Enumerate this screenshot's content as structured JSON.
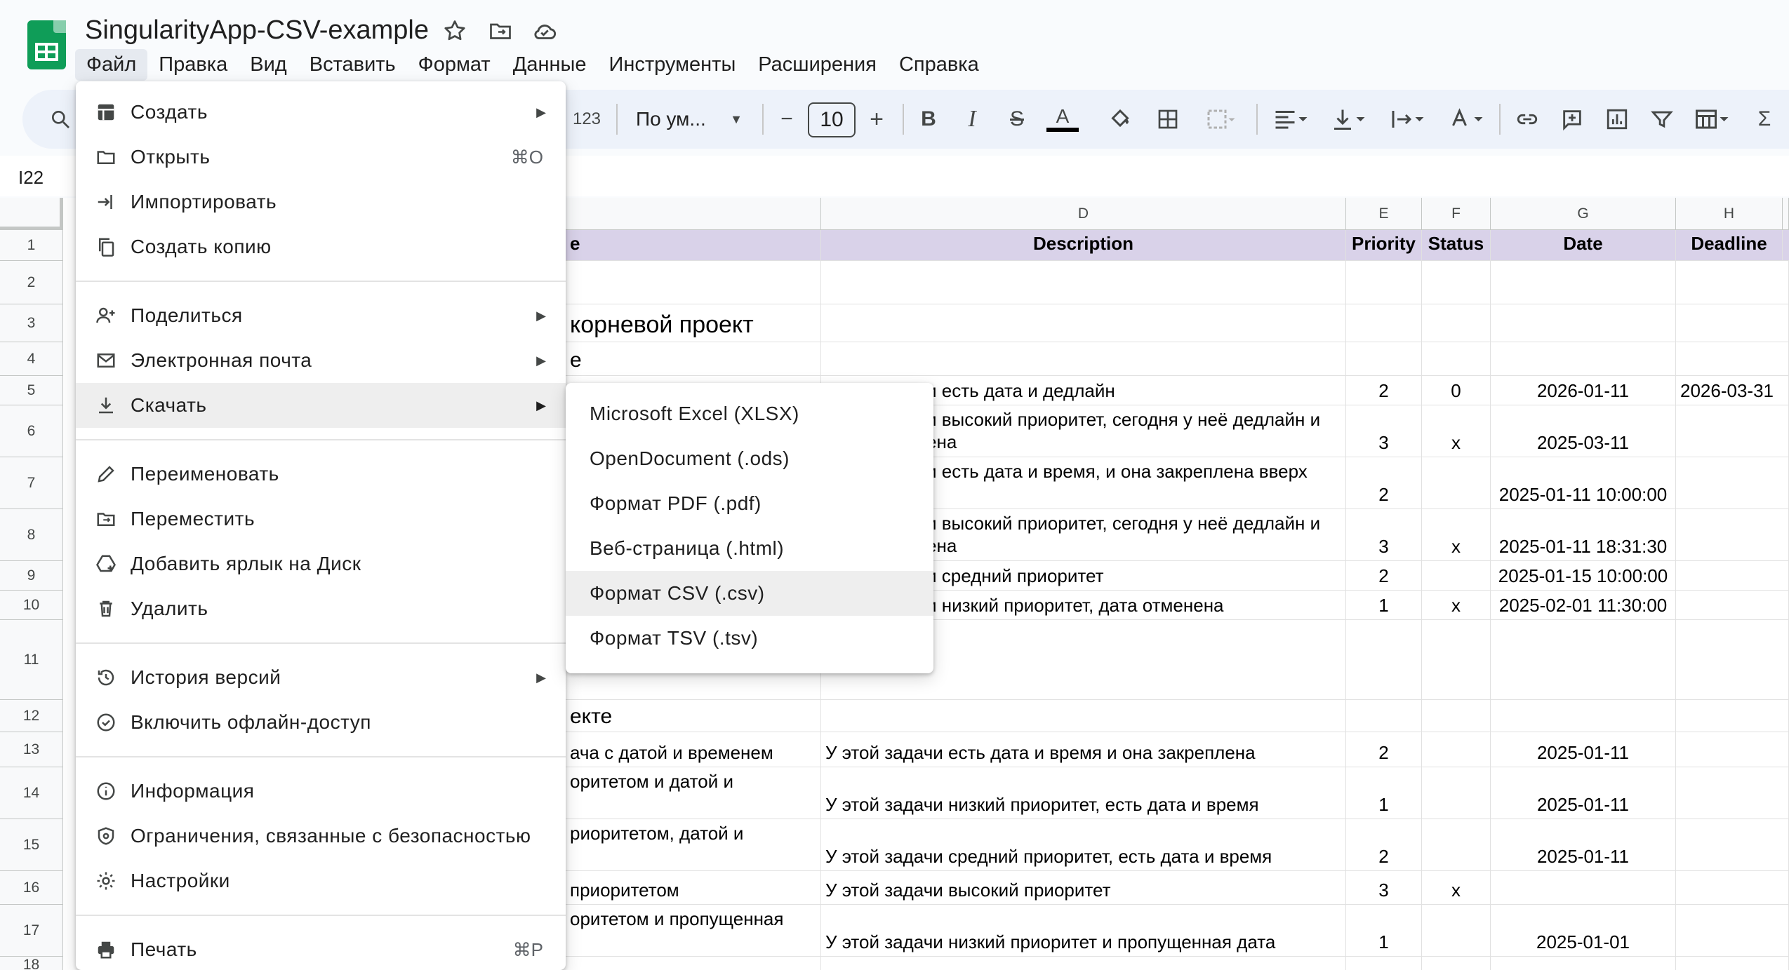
{
  "title_bar": {
    "doc_title": "SingularityApp-CSV-example"
  },
  "menubar": [
    "Файл",
    "Правка",
    "Вид",
    "Вставить",
    "Формат",
    "Данные",
    "Инструменты",
    "Расширения",
    "Справка"
  ],
  "toolbar": {
    "number_format_label": "123",
    "font_name": "По ум...",
    "font_size": "10",
    "text_color": "#000000"
  },
  "namebox": "I22",
  "columns": {
    "D": "D",
    "E": "E",
    "F": "F",
    "G": "G",
    "H": "H"
  },
  "rows": [
    "1",
    "2",
    "3",
    "4",
    "5",
    "6",
    "7",
    "8",
    "9",
    "10",
    "11",
    "12",
    "13",
    "14",
    "15",
    "16",
    "17",
    "18"
  ],
  "header_row": {
    "C_fragment": "e",
    "D": "Description",
    "E": "Priority",
    "F": "Status",
    "G": "Date",
    "H": "Deadline"
  },
  "cells": {
    "r3_C": "корневой проект",
    "r4_C": "е",
    "r5_D": "и есть дата и дедлайн",
    "r5_E": "2",
    "r5_F": "0",
    "r5_G": "2026-01-11",
    "r5_H": "2026-03-31",
    "r6_D": "и высокий приоритет, сегодня у неё дедлайн и ена",
    "r6_E": "3",
    "r6_F": "x",
    "r6_G": "2025-03-11",
    "r7_D": "и есть дата и время, и она закреплена вверх",
    "r7_E": "2",
    "r7_G": "2025-01-11 10:00:00",
    "r8_D": "и высокий приоритет, сегодня у неё дедлайн и ена",
    "r8_E": "3",
    "r8_F": "x",
    "r8_G": "2025-01-11 18:31:30",
    "r9_D": "и средний приоритет",
    "r9_E": "2",
    "r9_G": "2025-01-15 10:00:00",
    "r10_D": "и низкий приоритет, дата отменена",
    "r10_E": "1",
    "r10_F": "x",
    "r10_G": "2025-02-01 11:30:00",
    "r12_C": "екте",
    "r13_C": "ача с датой и временем",
    "r13_D": "У этой задачи есть дата и время и она закреплена",
    "r13_E": "2",
    "r13_G": "2025-01-11",
    "r14_C": "оритетом и датой и",
    "r14_D": "У этой задачи низкий приоритет, есть дата и время",
    "r14_E": "1",
    "r14_G": "2025-01-11",
    "r15_C": "риоритетом, датой и",
    "r15_D": "У этой задачи средний приоритет, есть дата и время",
    "r15_E": "2",
    "r15_G": "2025-01-11",
    "r16_C": "приоритетом",
    "r16_D": "У этой задачи высокий приоритет",
    "r16_E": "3",
    "r16_F": "x",
    "r17_C": "оритетом и пропущенная",
    "r17_D": "У этой задачи низкий приоритет и пропущенная дата",
    "r17_E": "1",
    "r17_G": "2025-01-01"
  },
  "file_menu": {
    "items": [
      {
        "label": "Создать",
        "icon": "new-sheet-icon",
        "submenu": true
      },
      {
        "label": "Открыть",
        "icon": "folder-icon",
        "shortcut": "⌘O"
      },
      {
        "label": "Импортировать",
        "icon": "import-icon"
      },
      {
        "label": "Создать копию",
        "icon": "copy-icon"
      },
      {
        "label": "Поделиться",
        "icon": "share-person-icon",
        "submenu": true
      },
      {
        "label": "Электронная почта",
        "icon": "mail-icon",
        "submenu": true
      },
      {
        "label": "Скачать",
        "icon": "download-icon",
        "submenu": true
      },
      {
        "label": "Переименовать",
        "icon": "pencil-icon"
      },
      {
        "label": "Переместить",
        "icon": "move-folder-icon"
      },
      {
        "label": "Добавить ярлык на Диск",
        "icon": "drive-shortcut-icon"
      },
      {
        "label": "Удалить",
        "icon": "trash-icon"
      },
      {
        "label": "История версий",
        "icon": "history-icon",
        "submenu": true
      },
      {
        "label": "Включить офлайн-доступ",
        "icon": "offline-icon"
      },
      {
        "label": "Информация",
        "icon": "info-icon"
      },
      {
        "label": "Ограничения, связанные с безопасностью",
        "icon": "security-shield-icon"
      },
      {
        "label": "Настройки",
        "icon": "settings-gear-icon"
      },
      {
        "label": "Печать",
        "icon": "printer-icon",
        "shortcut": "⌘P"
      }
    ]
  },
  "download_submenu": {
    "items": [
      "Microsoft Excel (XLSX)",
      "OpenDocument (.ods)",
      "Формат PDF (.pdf)",
      "Веб-страница (.html)",
      "Формат CSV (.csv)",
      "Формат TSV (.tsv)"
    ]
  },
  "colors": {
    "header_fill": "#d9d2e9",
    "sheets_green": "#0f9d58",
    "toolbar_bg": "#edf2fa",
    "menu_highlight": "#eeeeee"
  }
}
